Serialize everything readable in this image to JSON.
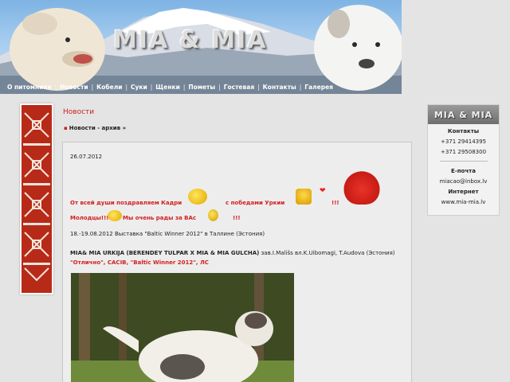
{
  "header": {
    "site_title": "MIA & MIA"
  },
  "nav": {
    "items": [
      "О питомнике",
      "Новости",
      "Кобели",
      "Суки",
      "Щенки",
      "Пометы",
      "Гостевая",
      "Контакты",
      "Галерея"
    ]
  },
  "main": {
    "heading": "Новости",
    "archive_link": "Новости - архив »",
    "news": {
      "date": "26.07.2012",
      "greeting_part1": "От всей души поздравляем Кадри",
      "greeting_part2": "с победами Уркии",
      "greeting_part3": "!!!",
      "greeting_line2a": "Молодцы!!!",
      "greeting_line2b": "Мы очень рады за ВАс",
      "greeting_line2c": "!!!",
      "event": "18.-19.08.2012 Выставка \"Baltic Winner 2012\" в Таллине (Эстония)",
      "dog_name": "MIA& MIA URKIJA (BERENDEY TULPAR X MIA & MIA GULCHA)",
      "owner": " зав.I.Mališs вл.K.Uibomagi, T.Audova (Эстония)",
      "result": "\"Отлично\", CACIB, \"Baltic Winner 2012\", ЛС"
    }
  },
  "sidebar": {
    "logo": "MIA & MIA",
    "contacts_label": "Контакты",
    "phone1": "+371 29414395",
    "phone2": "+371 29508300",
    "email_label": "E-почта",
    "email": "miacao@inbox.lv",
    "internet_label": "Интернет",
    "website": "www.mia-mia.lv"
  },
  "colors": {
    "accent_red": "#d42020",
    "background": "#e4e4e4",
    "ornament": "#b82a18"
  }
}
